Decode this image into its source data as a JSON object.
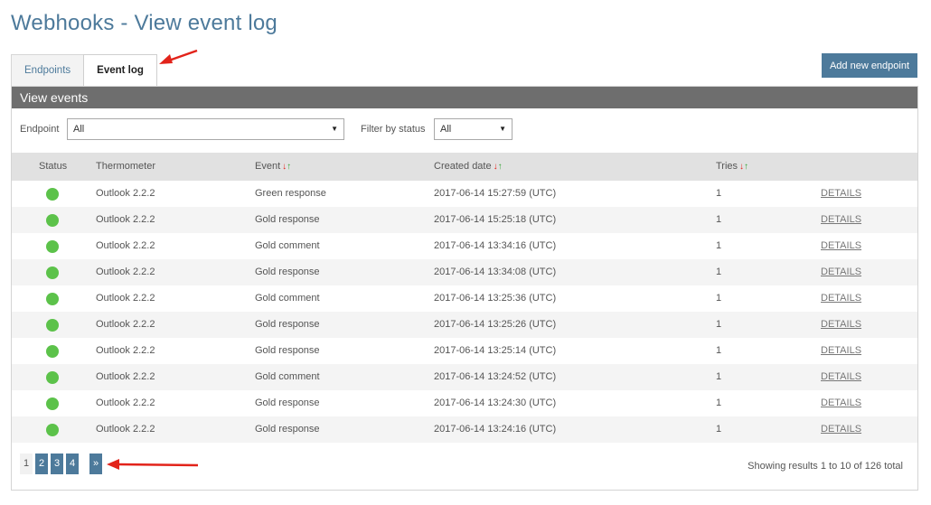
{
  "page": {
    "title": "Webhooks - View event log"
  },
  "tabs": [
    {
      "label": "Endpoints",
      "active": false
    },
    {
      "label": "Event log",
      "active": true
    }
  ],
  "toolbar": {
    "add_label": "Add new endpoint"
  },
  "panel": {
    "title": "View events"
  },
  "filters": {
    "endpoint_label": "Endpoint",
    "endpoint_value": "All",
    "status_label": "Filter by status",
    "status_value": "All"
  },
  "table": {
    "columns": {
      "status": "Status",
      "thermometer": "Thermometer",
      "event": "Event",
      "created": "Created date",
      "tries": "Tries"
    },
    "details_label": "DETAILS",
    "rows": [
      {
        "thermometer": "Outlook 2.2.2",
        "event": "Green response",
        "created": "2017-06-14 15:27:59 (UTC)",
        "tries": "1"
      },
      {
        "thermometer": "Outlook 2.2.2",
        "event": "Gold response",
        "created": "2017-06-14 15:25:18 (UTC)",
        "tries": "1"
      },
      {
        "thermometer": "Outlook 2.2.2",
        "event": "Gold comment",
        "created": "2017-06-14 13:34:16 (UTC)",
        "tries": "1"
      },
      {
        "thermometer": "Outlook 2.2.2",
        "event": "Gold response",
        "created": "2017-06-14 13:34:08 (UTC)",
        "tries": "1"
      },
      {
        "thermometer": "Outlook 2.2.2",
        "event": "Gold comment",
        "created": "2017-06-14 13:25:36 (UTC)",
        "tries": "1"
      },
      {
        "thermometer": "Outlook 2.2.2",
        "event": "Gold response",
        "created": "2017-06-14 13:25:26 (UTC)",
        "tries": "1"
      },
      {
        "thermometer": "Outlook 2.2.2",
        "event": "Gold response",
        "created": "2017-06-14 13:25:14 (UTC)",
        "tries": "1"
      },
      {
        "thermometer": "Outlook 2.2.2",
        "event": "Gold comment",
        "created": "2017-06-14 13:24:52 (UTC)",
        "tries": "1"
      },
      {
        "thermometer": "Outlook 2.2.2",
        "event": "Gold response",
        "created": "2017-06-14 13:24:30 (UTC)",
        "tries": "1"
      },
      {
        "thermometer": "Outlook 2.2.2",
        "event": "Gold response",
        "created": "2017-06-14 13:24:16 (UTC)",
        "tries": "1"
      }
    ]
  },
  "pagination": {
    "pages": [
      "1",
      "2",
      "3",
      "4"
    ],
    "current": "1",
    "next_label": "»",
    "results_text": "Showing results 1 to 10 of 126 total"
  },
  "icons": {
    "sort_desc": "↓",
    "sort_asc": "↑",
    "select_arrow": "▼"
  },
  "colors": {
    "accent": "#4d7a9b",
    "status_ok": "#5cc24a",
    "sort_desc": "#e2231a",
    "sort_asc": "#3aa63a",
    "annotation_arrow": "#e2231a"
  }
}
